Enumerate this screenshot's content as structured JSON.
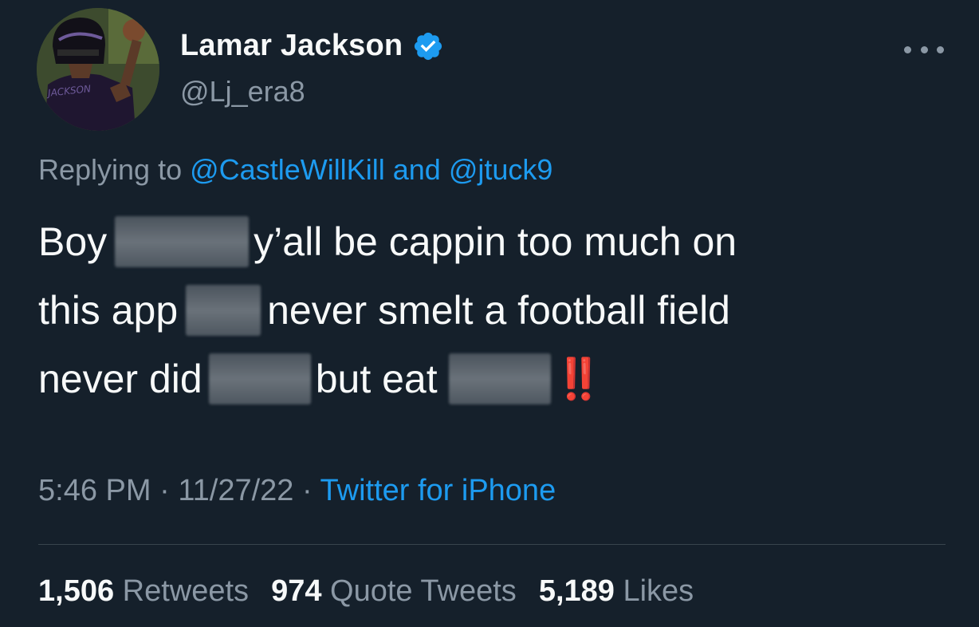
{
  "author": {
    "display_name": "Lamar Jackson",
    "handle": "@Lj_era8",
    "verified": true,
    "avatar_jersey_text": "JACKSON"
  },
  "reply": {
    "prefix": "Replying to",
    "mention_1": "@CastleWillKill",
    "conjunction": "and",
    "mention_2": "@jtuck9"
  },
  "body": {
    "line1_a": "Boy",
    "line1_b": "y’all be cappin too much on",
    "line2_a": "this app",
    "line2_b": "never smelt a football field",
    "line3_a": "never did",
    "line3_b": "but eat",
    "emphasis": "‼️",
    "redacted_icon": "blurred-redaction"
  },
  "meta": {
    "time": "5:46 PM",
    "separator": "·",
    "date": "11/27/22",
    "source": "Twitter for iPhone"
  },
  "stats": {
    "retweets_count": "1,506",
    "retweets_label": "Retweets",
    "quotes_count": "974",
    "quotes_label": "Quote Tweets",
    "likes_count": "5,189",
    "likes_label": "Likes"
  },
  "colors": {
    "background": "#15202b",
    "link": "#1d9bf0",
    "secondary_text": "#8b98a5",
    "primary_text": "#f7f9f9",
    "emphasis_red": "#e0322b"
  }
}
